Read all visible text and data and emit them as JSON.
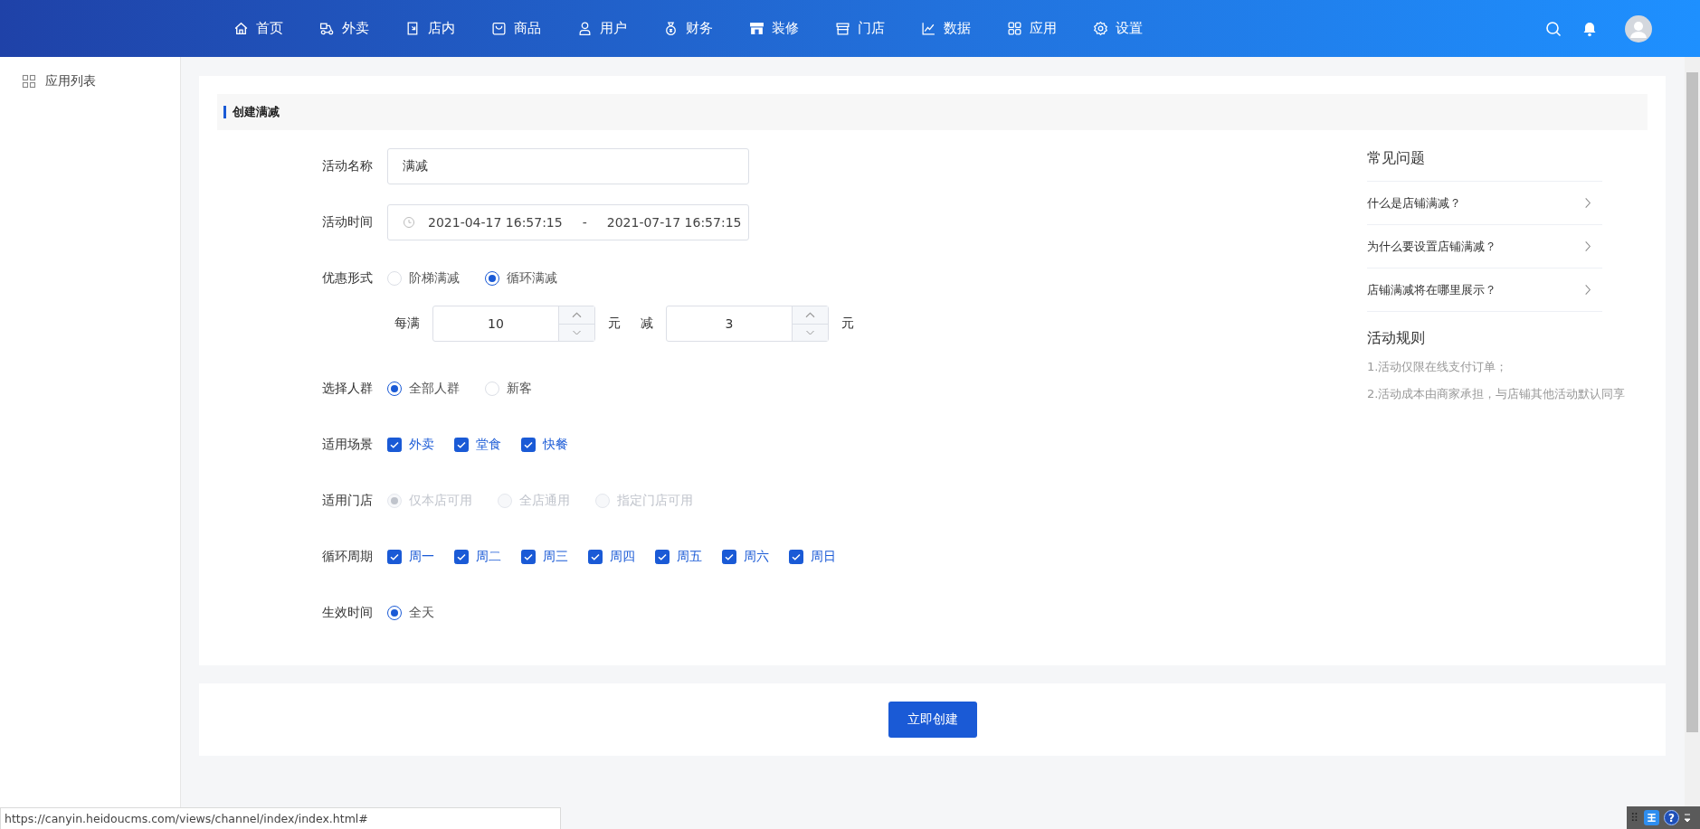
{
  "nav": [
    {
      "label": "首页"
    },
    {
      "label": "外卖"
    },
    {
      "label": "店内"
    },
    {
      "label": "商品"
    },
    {
      "label": "用户"
    },
    {
      "label": "财务"
    },
    {
      "label": "装修"
    },
    {
      "label": "门店"
    },
    {
      "label": "数据"
    },
    {
      "label": "应用"
    },
    {
      "label": "设置"
    }
  ],
  "sidebar": {
    "items": [
      {
        "label": "应用列表",
        "selected": false
      }
    ]
  },
  "section_title": "创建满减",
  "form": [
    {
      "kind": "input",
      "label": "活动名称",
      "value": "满减"
    },
    {
      "kind": "daterange",
      "label": "活动时间",
      "start": "2021-04-17 16:57:15",
      "separator": "-",
      "end": "2021-07-17 16:57:15"
    },
    {
      "kind": "radio",
      "label": "优惠形式",
      "disabled": false,
      "options": [
        {
          "label": "阶梯满减",
          "selected": false
        },
        {
          "label": "循环满减",
          "selected": true
        }
      ]
    },
    {
      "kind": "amounts",
      "items": [
        {
          "prefix": "每满",
          "value": "10",
          "unit": "元"
        },
        {
          "prefix": "减",
          "value": "3",
          "unit": "元"
        }
      ]
    },
    {
      "kind": "radio",
      "label": "选择人群",
      "disabled": false,
      "options": [
        {
          "label": "全部人群",
          "selected": true
        },
        {
          "label": "新客",
          "selected": false
        }
      ]
    },
    {
      "kind": "checkbox",
      "label": "适用场景",
      "options": [
        {
          "label": "外卖",
          "checked": true
        },
        {
          "label": "堂食",
          "checked": true
        },
        {
          "label": "快餐",
          "checked": true
        }
      ]
    },
    {
      "kind": "radio",
      "label": "适用门店",
      "disabled": true,
      "options": [
        {
          "label": "仅本店可用",
          "selected": true
        },
        {
          "label": "全店通用",
          "selected": false
        },
        {
          "label": "指定门店可用",
          "selected": false
        }
      ]
    },
    {
      "kind": "checkbox",
      "label": "循环周期",
      "options": [
        {
          "label": "周一",
          "checked": true
        },
        {
          "label": "周二",
          "checked": true
        },
        {
          "label": "周三",
          "checked": true
        },
        {
          "label": "周四",
          "checked": true
        },
        {
          "label": "周五",
          "checked": true
        },
        {
          "label": "周六",
          "checked": true
        },
        {
          "label": "周日",
          "checked": true
        }
      ]
    },
    {
      "kind": "radio",
      "label": "生效时间",
      "disabled": false,
      "options": [
        {
          "label": "全天",
          "selected": true
        }
      ]
    }
  ],
  "faq": {
    "title": "常见问题",
    "items": [
      "什么是店铺满减？",
      "为什么要设置店铺满减？",
      "店铺满减将在哪里展示？"
    ]
  },
  "rules": {
    "title": "活动规则",
    "items": [
      "1.活动仅限在线支付订单；",
      "2.活动成本由商家承担，与店铺其他活动默认同享"
    ]
  },
  "submit": "立即创建",
  "status_url": "https://canyin.heidoucms.com/views/channel/index/index.html#",
  "tray": {
    "help": "?"
  }
}
